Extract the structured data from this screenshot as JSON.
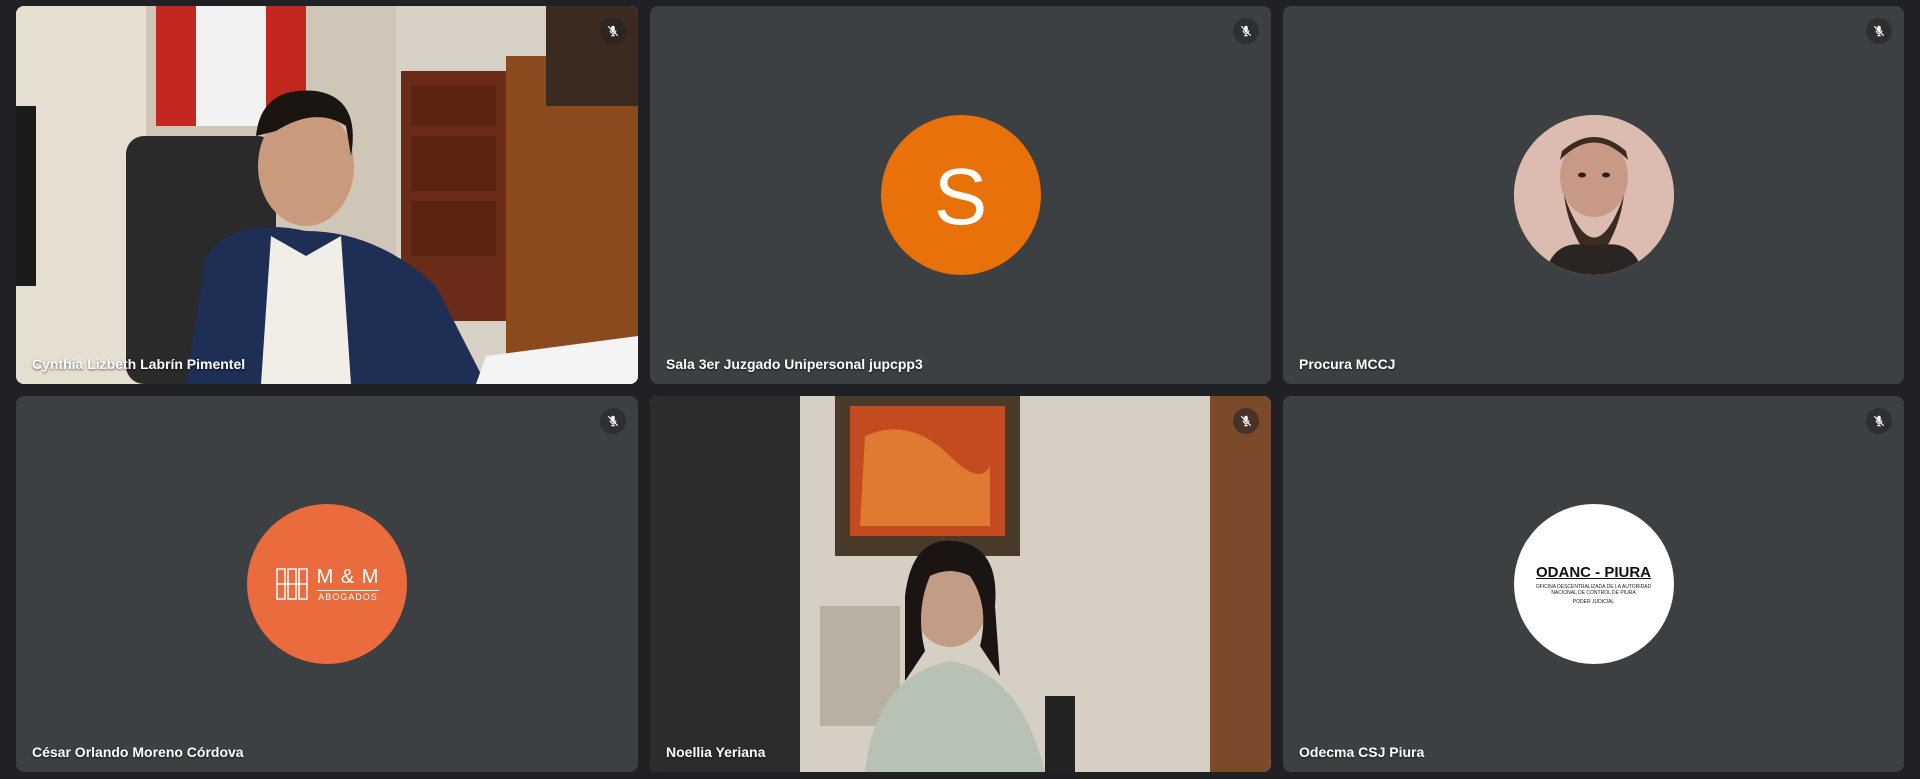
{
  "participants": [
    {
      "name": "Cynthia Lizbeth Labrín Pimentel",
      "type": "video",
      "muted": true
    },
    {
      "name": "Sala 3er Juzgado Unipersonal jupcpp3",
      "type": "initial",
      "initial": "S",
      "avatar_color": "#e8710a",
      "muted": true
    },
    {
      "name": "Procura MCCJ",
      "type": "photo",
      "muted": true
    },
    {
      "name": "César Orlando Moreno Córdova",
      "type": "logo",
      "logo_title": "M & M",
      "logo_subtitle": "ABOGADOS",
      "avatar_color": "#ea6b3d",
      "muted": true
    },
    {
      "name": "Noellia Yeriana",
      "type": "video",
      "muted": true
    },
    {
      "name": "Odecma CSJ Piura",
      "type": "logo",
      "logo_title": "ODANC - PIURA",
      "logo_subtitle": "OFICINA DESCENTRALIZADA DE LA AUTORIDAD NACIONAL DE CONTROL DE PIURA",
      "logo_footer": "PODER JUDICIAL",
      "avatar_color": "#ffffff",
      "muted": true
    }
  ],
  "icons": {
    "mute": "mic-off-icon"
  },
  "colors": {
    "background": "#202124",
    "tile": "#3c4043"
  }
}
